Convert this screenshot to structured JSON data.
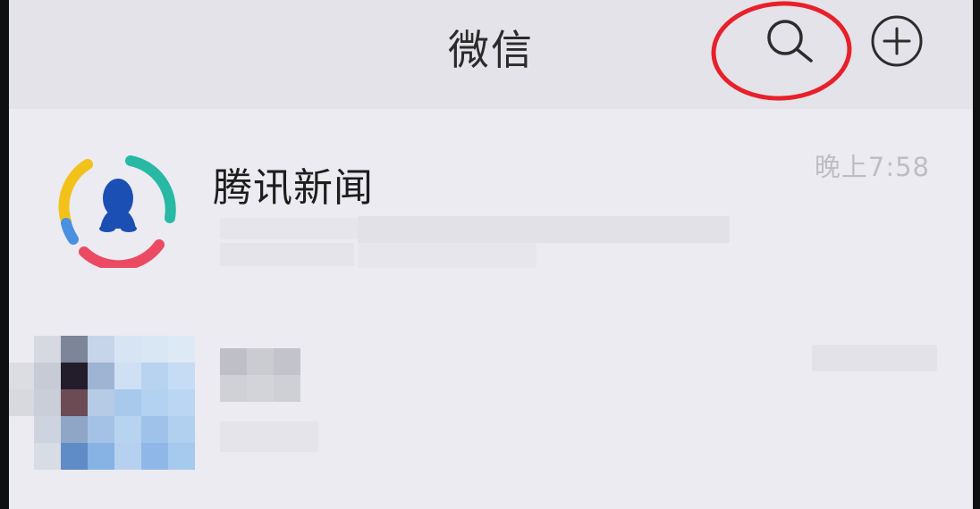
{
  "nav": {
    "title": "微信",
    "search_icon": "search-icon",
    "add_icon": "plus-circle-icon",
    "highlight_color": "#e8202a"
  },
  "chats": [
    {
      "name": "腾讯新闻",
      "time": "晚上7:58",
      "avatar": "tencent-news-logo"
    },
    {
      "avatar": "pixelated-avatar"
    }
  ]
}
